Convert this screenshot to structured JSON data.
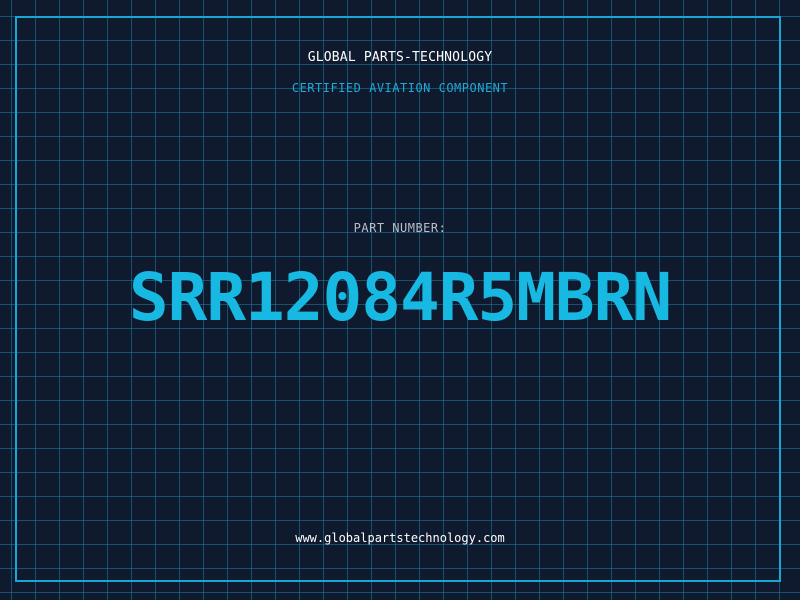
{
  "header": {
    "brand": "GLOBAL PARTS-TECHNOLOGY",
    "tagline": "CERTIFIED AVIATION COMPONENT"
  },
  "main": {
    "part_label": "PART NUMBER:",
    "part_number": "SRR12084R5MBRN"
  },
  "footer": {
    "website": "www.globalpartstechnology.com"
  },
  "colors": {
    "background": "#101a2e",
    "grid": "#1896be",
    "accent": "#17b8e2",
    "label": "#b9bfc9",
    "text": "#ffffff"
  }
}
